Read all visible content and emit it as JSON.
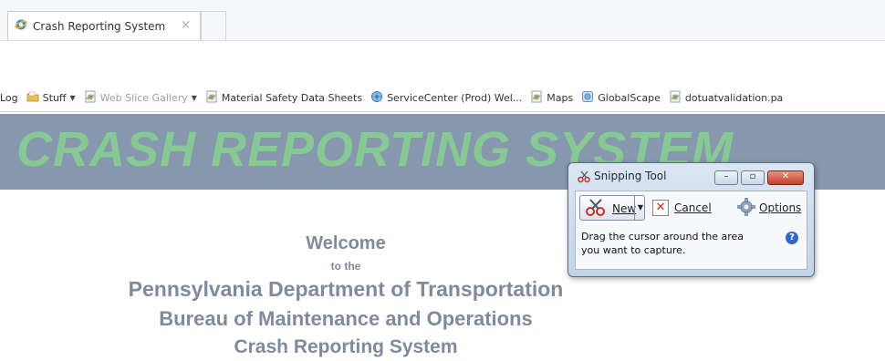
{
  "browser": {
    "tab": {
      "title": "Crash Reporting System",
      "close_glyph": "×"
    },
    "favorites": [
      {
        "label": "Log",
        "icon": "page-icon",
        "dropdown": false,
        "muted": false
      },
      {
        "label": "Stuff",
        "icon": "folder-icon",
        "dropdown": true,
        "muted": false
      },
      {
        "label": "Web Slice Gallery",
        "icon": "ie-page-icon",
        "dropdown": true,
        "muted": true
      },
      {
        "label": "Material Safety Data Sheets",
        "icon": "ie-page-icon",
        "dropdown": false,
        "muted": false
      },
      {
        "label": "ServiceCenter (Prod) Wel...",
        "icon": "servicecenter-icon",
        "dropdown": false,
        "muted": false
      },
      {
        "label": "Maps",
        "icon": "ie-page-icon",
        "dropdown": false,
        "muted": false
      },
      {
        "label": "GlobalScape",
        "icon": "globalscape-icon",
        "dropdown": false,
        "muted": false
      },
      {
        "label": "dotuatvalidation.pa",
        "icon": "ie-page-icon",
        "dropdown": false,
        "muted": false
      }
    ]
  },
  "page": {
    "banner_title": "CRASH REPORTING SYSTEM",
    "welcome": "Welcome",
    "to_the": "to the",
    "org": "Pennsylvania Department of Transportation",
    "bureau": "Bureau of Maintenance and Operations",
    "system": "Crash Reporting System"
  },
  "snipping_tool": {
    "title": "Snipping Tool",
    "new_label": "New",
    "cancel_label": "Cancel",
    "options_label": "Options",
    "message": "Drag the cursor around the area you want to capture.",
    "help_glyph": "?"
  },
  "colors": {
    "banner_bg": "#8798ae",
    "banner_text": "#86c995",
    "welcome_text": "#7f8b9c"
  }
}
